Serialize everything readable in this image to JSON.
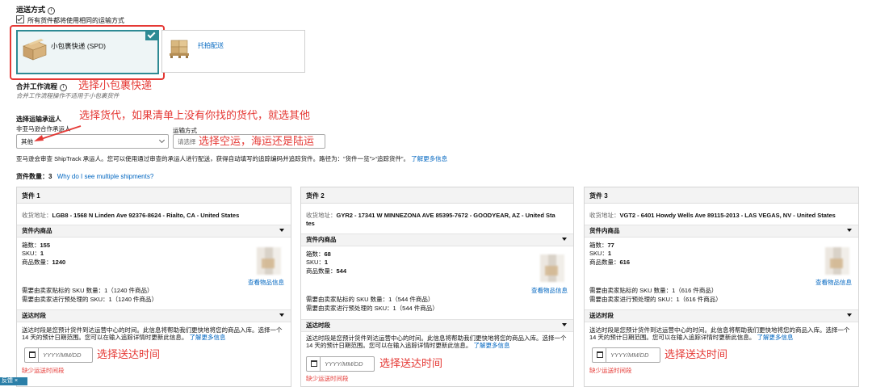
{
  "shipping": {
    "title": "运送方式",
    "same_method_label": "所有货件都将使用相同的运输方式",
    "option_spd": "小包裹快递 (SPD)",
    "option_ltl": "托拍配送"
  },
  "workflow": {
    "title": "合并工作流程",
    "note": "合并工作流程操作不适用于小包裹货件"
  },
  "carrier": {
    "title": "选择运输承运人",
    "non_partner_label": "非亚马逊合作承运人",
    "carrier_value": "其他",
    "mode_label": "运输方式",
    "mode_placeholder": "请选择",
    "notice": "亚马逊会审查 ShipTrack 承运人。您可以使用通过审查的承运人进行配送，获得自动填写的追踪编码并追踪货件。路径为：“货件一览”>“追踪货件”。",
    "learn_more": "了解更多信息"
  },
  "shipments_count": {
    "label": "货件数量：",
    "value": "3",
    "why_link": "Why do I see multiple shipments?"
  },
  "annotations": {
    "spd": "选择小包裹快递",
    "carrier": "选择货代，如果清单上没有你找的货代，就选其他",
    "mode": "选择空运，海运还是陆运",
    "date": "选择送达时间"
  },
  "shipment_labels": {
    "address_prefix": "收货地址：",
    "items_section": "货件内商品",
    "boxes": "箱数：",
    "sku": "SKU：",
    "units": "商品数量：",
    "view_info": "查看物品信息",
    "window_section": "送达时段",
    "window_desc": "送达时段是您预计货件到达运营中心的时间。此信息将帮助我们更快地将您的商品入库。选择一个 14 天的预计日期范围。您可以在输入追踪详情时更新此信息。",
    "window_link": "了解更多信息",
    "date_placeholder": "YYYY/MM/DD",
    "missing": "缺少运送时间段"
  },
  "shipments": [
    {
      "title": "货件 1",
      "address": "LGB8 - 1568 N Linden Ave 92376-8624 - Rialto, CA - United States",
      "boxes": "155",
      "sku": "1",
      "units": "1240",
      "label_line": "需要由卖家贴标的 SKU 数量：1（1240 件商品）",
      "prep_line": "需要由卖家进行预处理的 SKU：1（1240 件商品）"
    },
    {
      "title": "货件 2",
      "address_l1": "GYR2 - 17341 W MINNEZONA AVE 85395-7672 - GOODYEAR, AZ - United Sta",
      "address_l2": "tes",
      "boxes": "68",
      "sku": "1",
      "units": "544",
      "label_line": "需要由卖家贴标的 SKU 数量：1（544 件商品）",
      "prep_line": "需要由卖家进行预处理的 SKU：1（544 件商品）"
    },
    {
      "title": "货件 3",
      "address": "VGT2 - 6401 Howdy Wells Ave 89115-2013 - LAS VEGAS, NV - United States",
      "boxes": "77",
      "sku": "1",
      "units": "616",
      "label_line": "需要由卖家贴标的 SKU 数量：1（616 件商品）",
      "prep_line": "需要由卖家进行预处理的 SKU：1（616 件商品）"
    }
  ],
  "bottom_tag": "反馈",
  "colors": {
    "accent": "#2e8a94",
    "annotation": "#e53935",
    "link": "#0066c0"
  }
}
